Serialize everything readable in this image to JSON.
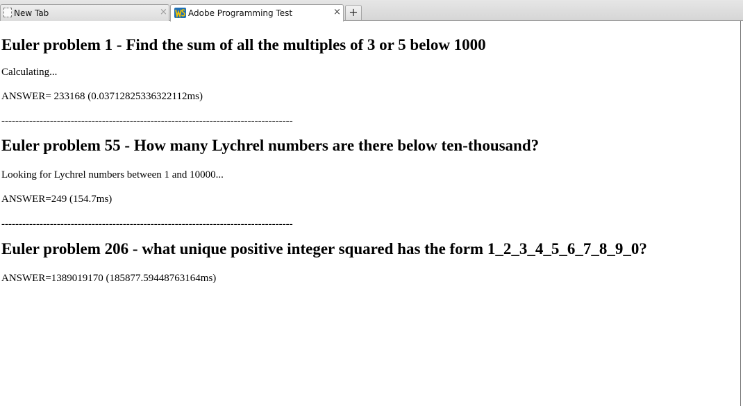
{
  "browser": {
    "tabs": [
      {
        "title": "New Tab",
        "active": false,
        "icon": "blank-page-icon"
      },
      {
        "title": "Adobe Programming Test",
        "active": true,
        "icon": "ws-favicon-icon"
      }
    ],
    "close_glyph": "×",
    "new_tab_glyph": "+"
  },
  "page": {
    "sections": [
      {
        "heading": "Euler problem 1 - Find the sum of all the multiples of 3 or 5 below 1000",
        "lines": [
          "Calculating...",
          "ANSWER= 233168 (0.03712825336322112ms)"
        ]
      },
      {
        "heading": "Euler problem 55 - How many Lychrel numbers are there below ten-thousand?",
        "lines": [
          "Looking for Lychrel numbers between 1 and 10000...",
          "ANSWER=249 (154.7ms)"
        ]
      },
      {
        "heading": "Euler problem 206 - what unique positive integer squared has the form 1_2_3_4_5_6_7_8_9_0?",
        "lines": [
          "ANSWER=1389019170 (185877.59448763164ms)"
        ]
      }
    ],
    "divider": "------------------------------------------------------------------------------------"
  }
}
